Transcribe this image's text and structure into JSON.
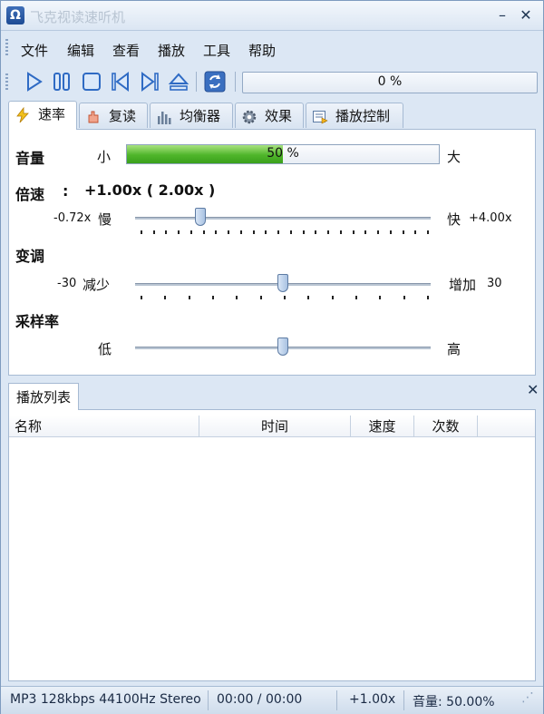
{
  "window": {
    "title": "飞克视读速听机",
    "icon_letter": "Ω"
  },
  "title_buttons": {
    "minimize": "–",
    "close": "✕"
  },
  "menu": [
    "文件",
    "编辑",
    "查看",
    "播放",
    "工具",
    "帮助"
  ],
  "toolbar": {
    "progress_text": "0 %"
  },
  "tabs": [
    "速率",
    "复读",
    "均衡器",
    "效果",
    "播放控制"
  ],
  "speed_panel": {
    "volume_label": "音量",
    "volume_min": "小",
    "volume_max": "大",
    "volume_text": "50 %",
    "volume_level_percent": 50,
    "speed_label": "倍速",
    "speed_colon": ":",
    "speed_value": "+1.00x ( 2.00x )",
    "speed_min_value": "-0.72x",
    "speed_min": "慢",
    "speed_max": "快",
    "speed_max_value": "+4.00x",
    "speed_slider_fraction": 0.22,
    "pitch_label": "变调",
    "pitch_min_value": "-30",
    "pitch_min": "减少",
    "pitch_max": "增加",
    "pitch_max_value": "30",
    "pitch_slider_fraction": 0.5,
    "samplerate_label": "采样率",
    "samplerate_min": "低",
    "samplerate_max": "高",
    "samplerate_slider_fraction": 0.5
  },
  "playlist": {
    "tab_label": "播放列表",
    "close": "✕",
    "columns": [
      "名称",
      "时间",
      "速度",
      "次数"
    ]
  },
  "status": {
    "format": "MP3 128kbps 44100Hz Stereo",
    "time": "00:00 / 00:00",
    "speed": "+1.00x",
    "volume": "音量: 50.00%"
  }
}
